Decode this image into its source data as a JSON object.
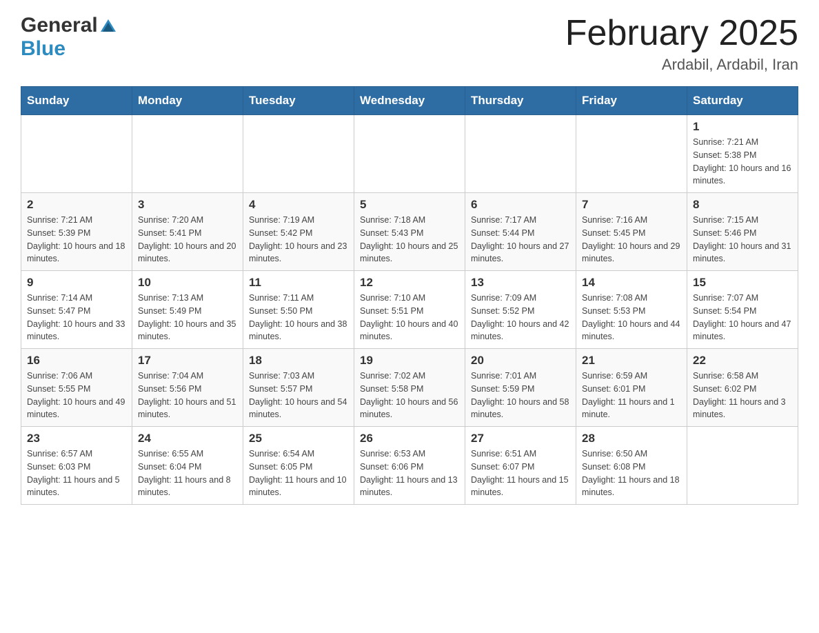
{
  "header": {
    "logo_general": "General",
    "logo_blue": "Blue",
    "month_title": "February 2025",
    "location": "Ardabil, Ardabil, Iran"
  },
  "weekdays": [
    "Sunday",
    "Monday",
    "Tuesday",
    "Wednesday",
    "Thursday",
    "Friday",
    "Saturday"
  ],
  "weeks": [
    [
      {
        "day": "",
        "sunrise": "",
        "sunset": "",
        "daylight": ""
      },
      {
        "day": "",
        "sunrise": "",
        "sunset": "",
        "daylight": ""
      },
      {
        "day": "",
        "sunrise": "",
        "sunset": "",
        "daylight": ""
      },
      {
        "day": "",
        "sunrise": "",
        "sunset": "",
        "daylight": ""
      },
      {
        "day": "",
        "sunrise": "",
        "sunset": "",
        "daylight": ""
      },
      {
        "day": "",
        "sunrise": "",
        "sunset": "",
        "daylight": ""
      },
      {
        "day": "1",
        "sunrise": "Sunrise: 7:21 AM",
        "sunset": "Sunset: 5:38 PM",
        "daylight": "Daylight: 10 hours and 16 minutes."
      }
    ],
    [
      {
        "day": "2",
        "sunrise": "Sunrise: 7:21 AM",
        "sunset": "Sunset: 5:39 PM",
        "daylight": "Daylight: 10 hours and 18 minutes."
      },
      {
        "day": "3",
        "sunrise": "Sunrise: 7:20 AM",
        "sunset": "Sunset: 5:41 PM",
        "daylight": "Daylight: 10 hours and 20 minutes."
      },
      {
        "day": "4",
        "sunrise": "Sunrise: 7:19 AM",
        "sunset": "Sunset: 5:42 PM",
        "daylight": "Daylight: 10 hours and 23 minutes."
      },
      {
        "day": "5",
        "sunrise": "Sunrise: 7:18 AM",
        "sunset": "Sunset: 5:43 PM",
        "daylight": "Daylight: 10 hours and 25 minutes."
      },
      {
        "day": "6",
        "sunrise": "Sunrise: 7:17 AM",
        "sunset": "Sunset: 5:44 PM",
        "daylight": "Daylight: 10 hours and 27 minutes."
      },
      {
        "day": "7",
        "sunrise": "Sunrise: 7:16 AM",
        "sunset": "Sunset: 5:45 PM",
        "daylight": "Daylight: 10 hours and 29 minutes."
      },
      {
        "day": "8",
        "sunrise": "Sunrise: 7:15 AM",
        "sunset": "Sunset: 5:46 PM",
        "daylight": "Daylight: 10 hours and 31 minutes."
      }
    ],
    [
      {
        "day": "9",
        "sunrise": "Sunrise: 7:14 AM",
        "sunset": "Sunset: 5:47 PM",
        "daylight": "Daylight: 10 hours and 33 minutes."
      },
      {
        "day": "10",
        "sunrise": "Sunrise: 7:13 AM",
        "sunset": "Sunset: 5:49 PM",
        "daylight": "Daylight: 10 hours and 35 minutes."
      },
      {
        "day": "11",
        "sunrise": "Sunrise: 7:11 AM",
        "sunset": "Sunset: 5:50 PM",
        "daylight": "Daylight: 10 hours and 38 minutes."
      },
      {
        "day": "12",
        "sunrise": "Sunrise: 7:10 AM",
        "sunset": "Sunset: 5:51 PM",
        "daylight": "Daylight: 10 hours and 40 minutes."
      },
      {
        "day": "13",
        "sunrise": "Sunrise: 7:09 AM",
        "sunset": "Sunset: 5:52 PM",
        "daylight": "Daylight: 10 hours and 42 minutes."
      },
      {
        "day": "14",
        "sunrise": "Sunrise: 7:08 AM",
        "sunset": "Sunset: 5:53 PM",
        "daylight": "Daylight: 10 hours and 44 minutes."
      },
      {
        "day": "15",
        "sunrise": "Sunrise: 7:07 AM",
        "sunset": "Sunset: 5:54 PM",
        "daylight": "Daylight: 10 hours and 47 minutes."
      }
    ],
    [
      {
        "day": "16",
        "sunrise": "Sunrise: 7:06 AM",
        "sunset": "Sunset: 5:55 PM",
        "daylight": "Daylight: 10 hours and 49 minutes."
      },
      {
        "day": "17",
        "sunrise": "Sunrise: 7:04 AM",
        "sunset": "Sunset: 5:56 PM",
        "daylight": "Daylight: 10 hours and 51 minutes."
      },
      {
        "day": "18",
        "sunrise": "Sunrise: 7:03 AM",
        "sunset": "Sunset: 5:57 PM",
        "daylight": "Daylight: 10 hours and 54 minutes."
      },
      {
        "day": "19",
        "sunrise": "Sunrise: 7:02 AM",
        "sunset": "Sunset: 5:58 PM",
        "daylight": "Daylight: 10 hours and 56 minutes."
      },
      {
        "day": "20",
        "sunrise": "Sunrise: 7:01 AM",
        "sunset": "Sunset: 5:59 PM",
        "daylight": "Daylight: 10 hours and 58 minutes."
      },
      {
        "day": "21",
        "sunrise": "Sunrise: 6:59 AM",
        "sunset": "Sunset: 6:01 PM",
        "daylight": "Daylight: 11 hours and 1 minute."
      },
      {
        "day": "22",
        "sunrise": "Sunrise: 6:58 AM",
        "sunset": "Sunset: 6:02 PM",
        "daylight": "Daylight: 11 hours and 3 minutes."
      }
    ],
    [
      {
        "day": "23",
        "sunrise": "Sunrise: 6:57 AM",
        "sunset": "Sunset: 6:03 PM",
        "daylight": "Daylight: 11 hours and 5 minutes."
      },
      {
        "day": "24",
        "sunrise": "Sunrise: 6:55 AM",
        "sunset": "Sunset: 6:04 PM",
        "daylight": "Daylight: 11 hours and 8 minutes."
      },
      {
        "day": "25",
        "sunrise": "Sunrise: 6:54 AM",
        "sunset": "Sunset: 6:05 PM",
        "daylight": "Daylight: 11 hours and 10 minutes."
      },
      {
        "day": "26",
        "sunrise": "Sunrise: 6:53 AM",
        "sunset": "Sunset: 6:06 PM",
        "daylight": "Daylight: 11 hours and 13 minutes."
      },
      {
        "day": "27",
        "sunrise": "Sunrise: 6:51 AM",
        "sunset": "Sunset: 6:07 PM",
        "daylight": "Daylight: 11 hours and 15 minutes."
      },
      {
        "day": "28",
        "sunrise": "Sunrise: 6:50 AM",
        "sunset": "Sunset: 6:08 PM",
        "daylight": "Daylight: 11 hours and 18 minutes."
      },
      {
        "day": "",
        "sunrise": "",
        "sunset": "",
        "daylight": ""
      }
    ]
  ]
}
